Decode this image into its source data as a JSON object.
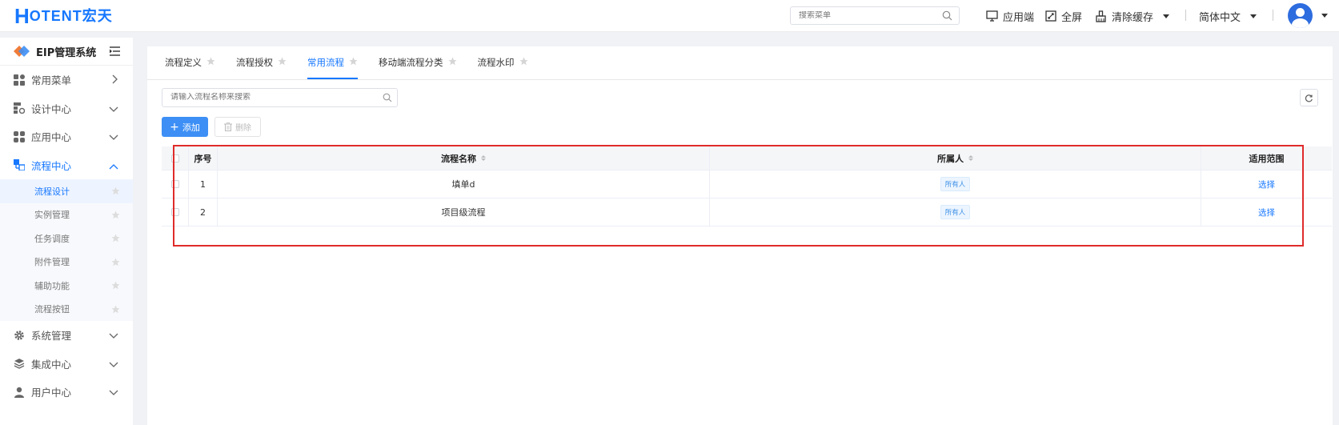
{
  "header": {
    "logo_h": "H",
    "logo_text": "OTENT宏天",
    "search_placeholder": "搜索菜单",
    "app_label": "应用端",
    "fullscreen_label": "全屏",
    "clear_cache_label": "清除缓存",
    "language_label": "简体中文"
  },
  "sidebar": {
    "title": "EIP管理系统",
    "items": [
      {
        "label": "常用菜单",
        "icon": "apps-icon"
      },
      {
        "label": "设计中心",
        "icon": "design-icon"
      },
      {
        "label": "应用中心",
        "icon": "app-grid-icon"
      },
      {
        "label": "流程中心",
        "icon": "flow-icon"
      },
      {
        "label": "系统管理",
        "icon": "gear-icon"
      },
      {
        "label": "集成中心",
        "icon": "layers-icon"
      },
      {
        "label": "用户中心",
        "icon": "user-icon"
      }
    ],
    "sub_items": [
      "流程设计",
      "实例管理",
      "任务调度",
      "附件管理",
      "辅助功能",
      "流程按钮"
    ]
  },
  "tabs": [
    "流程定义",
    "流程授权",
    "常用流程",
    "移动端流程分类",
    "流程水印"
  ],
  "toolbar": {
    "search_placeholder": "请输入流程名称来搜索",
    "add_label": "添加",
    "delete_label": "删除"
  },
  "table": {
    "columns": [
      "序号",
      "流程名称",
      "所属人",
      "适用范围"
    ],
    "rows": [
      {
        "index": "1",
        "name": "填单d",
        "owner": "所有人",
        "scope": "选择"
      },
      {
        "index": "2",
        "name": "项目级流程",
        "owner": "所有人",
        "scope": "选择"
      }
    ]
  },
  "colors": {
    "accent": "#1677ff",
    "highlight_border": "#e02b2b"
  }
}
